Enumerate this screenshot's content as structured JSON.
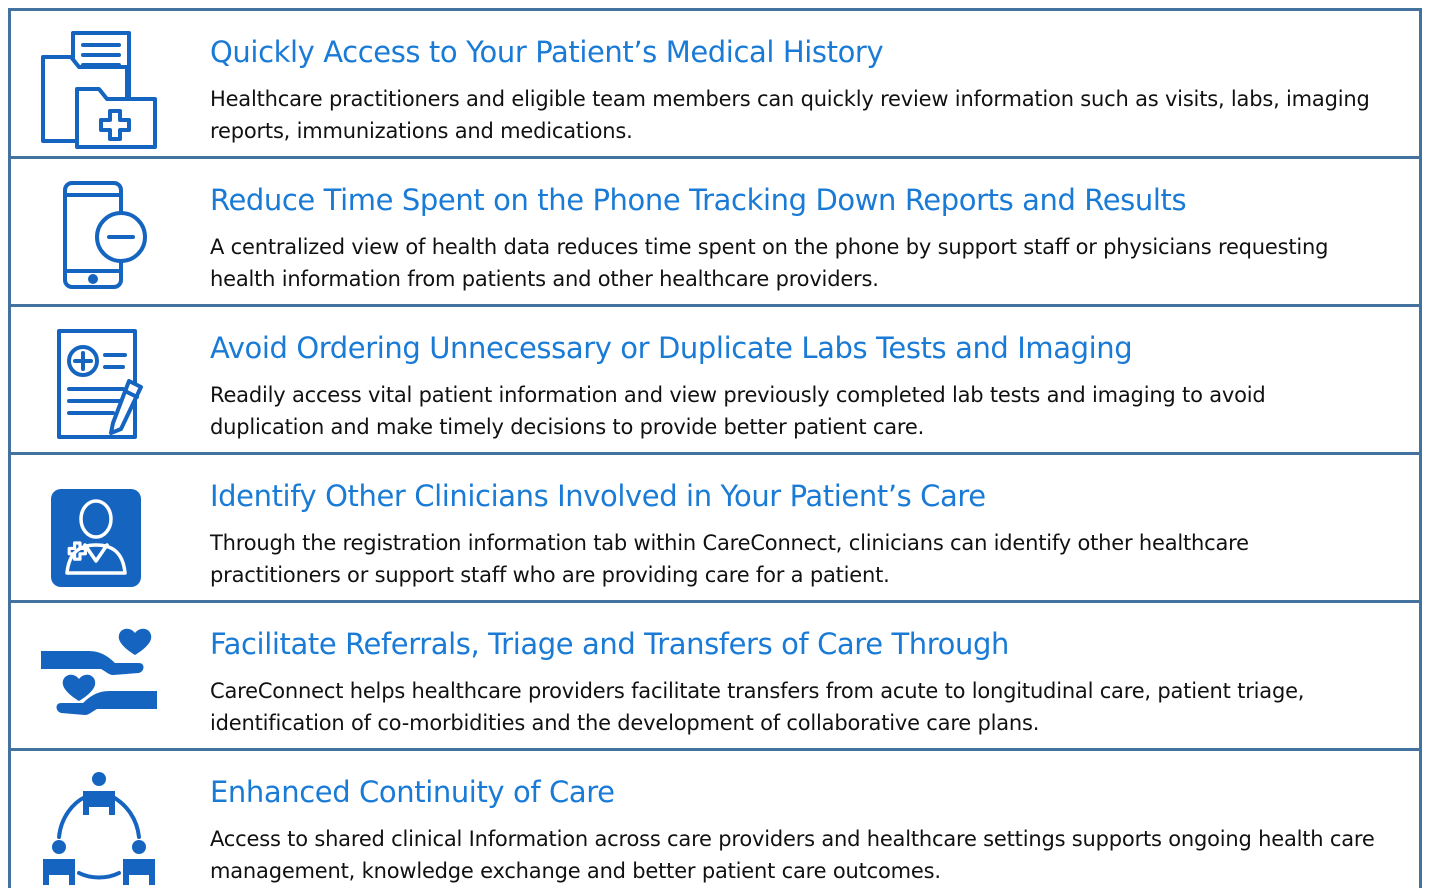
{
  "colors": {
    "border": "#43729f",
    "title": "#1a7bd6",
    "icon": "#1565c0",
    "text": "#111111"
  },
  "items": [
    {
      "icon": "medical-folder-icon",
      "title": "Quickly Access to Your Patient’s Medical History",
      "description": "Healthcare practitioners and eligible team members can quickly review information such as visits, labs, imaging reports, immunizations and medications."
    },
    {
      "icon": "phone-icon",
      "title": "Reduce Time Spent on the Phone Tracking Down Reports and Results",
      "description": "A centralized view of health data reduces time spent on the phone by support staff or physicians requesting health information from patients and other healthcare providers."
    },
    {
      "icon": "lab-order-icon",
      "title": "Avoid Ordering Unnecessary or Duplicate Labs Tests and Imaging",
      "description": "Readily access vital patient information and view previously completed lab tests and imaging to avoid duplication and make timely decisions to provide better patient care."
    },
    {
      "icon": "clinician-icon",
      "title": "Identify Other Clinicians Involved in Your Patient’s Care",
      "description": "Through the registration information tab within CareConnect, clinicians can identify other healthcare practitioners or support staff who are providing care for a patient."
    },
    {
      "icon": "helping-hands-heart-icon",
      "title": "Facilitate Referrals, Triage and Transfers of Care Through",
      "description": "CareConnect helps healthcare providers facilitate transfers from acute to longitudinal care, patient triage, identification of co-morbidities and the development of collaborative care plans."
    },
    {
      "icon": "care-team-cycle-icon",
      "title": "Enhanced Continuity of Care",
      "description": "Access to shared clinical Information across care providers and healthcare settings supports ongoing health care management, knowledge exchange and better patient care outcomes."
    }
  ]
}
